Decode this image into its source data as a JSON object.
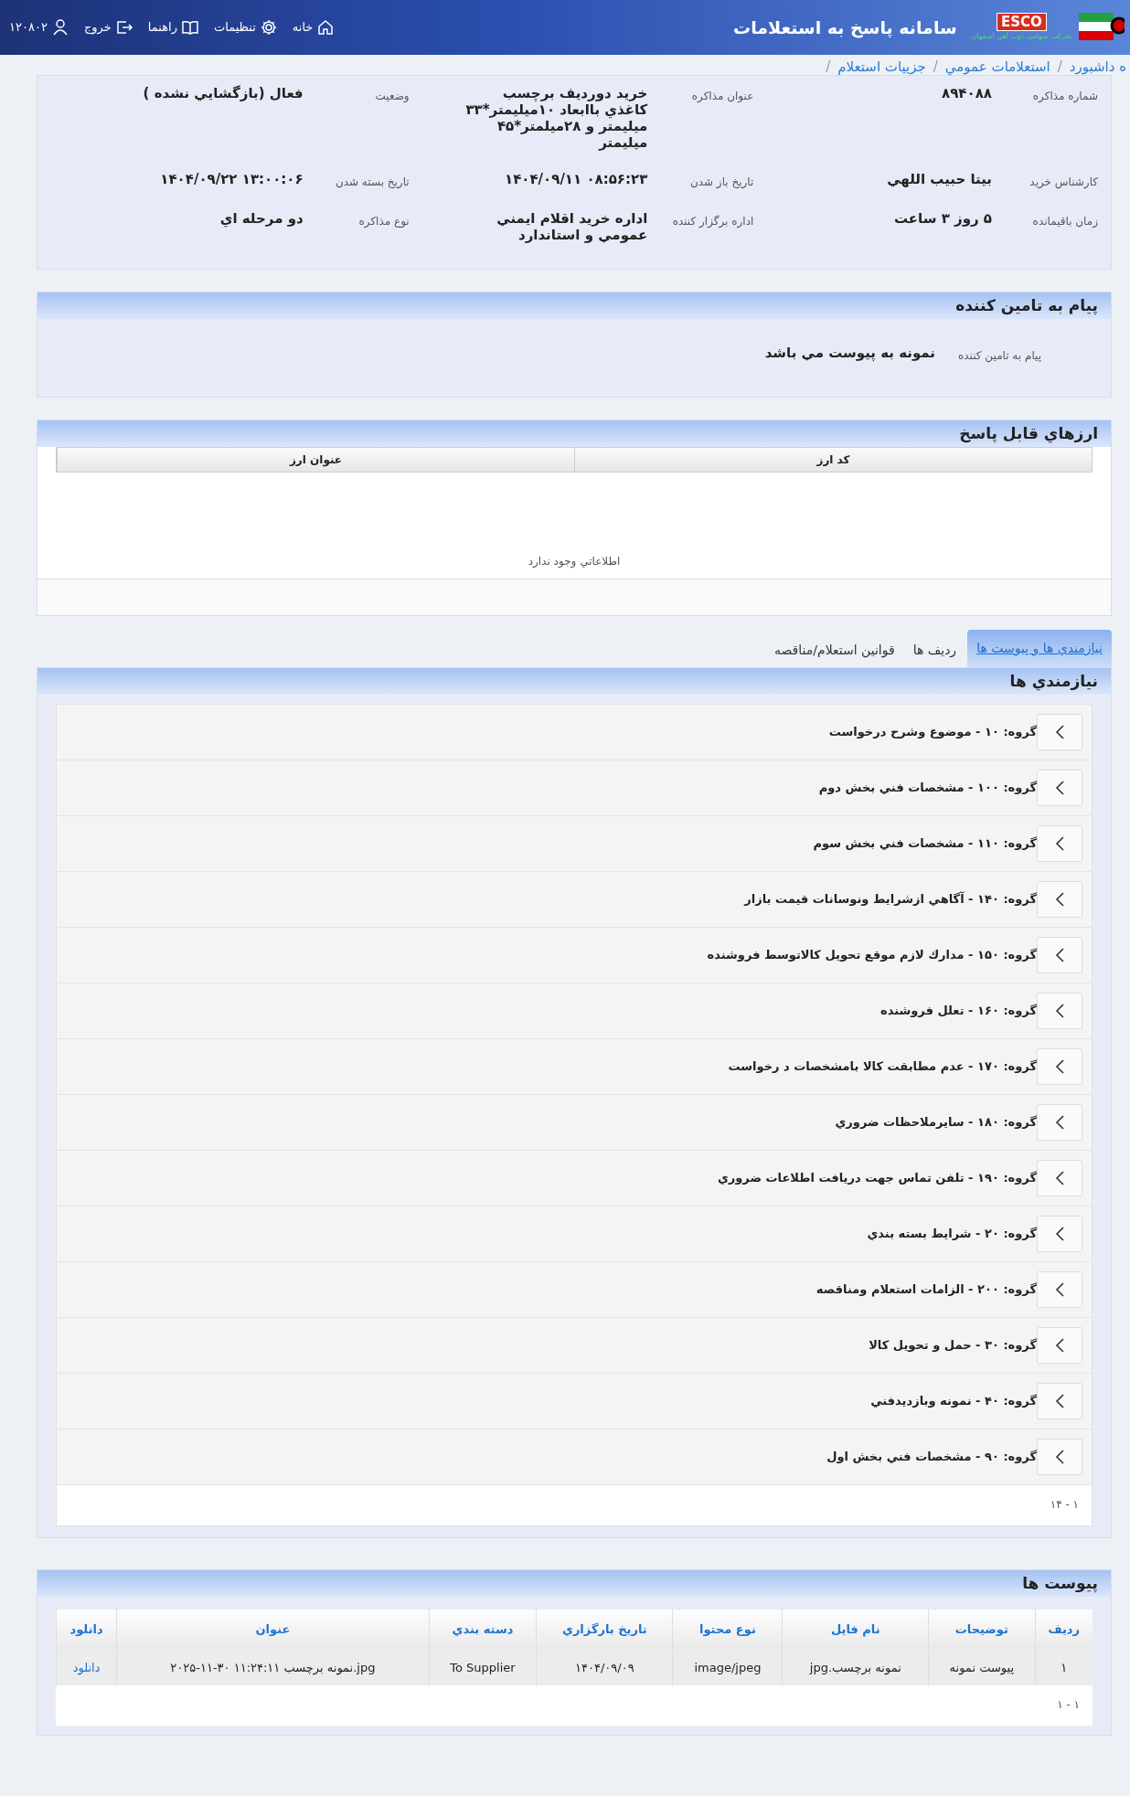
{
  "header": {
    "logo": {
      "brand": "ESCO",
      "company": "شرکت سهامی ذوب آهن اصفهان"
    },
    "title": "سامانه پاسخ به استعلامات",
    "nav": [
      {
        "kind": "home",
        "label": "خانه"
      },
      {
        "kind": "settings",
        "label": "تنظيمات"
      },
      {
        "kind": "help",
        "label": "راهنما"
      },
      {
        "kind": "logout",
        "label": "خروج"
      },
      {
        "kind": "user",
        "label": "۱۲۰۸۰۲"
      }
    ]
  },
  "breadcrumb": {
    "separator": "/",
    "items": [
      "ه داشبورد",
      "استعلامات عمومي",
      "جزييات استعلام"
    ]
  },
  "details": [
    {
      "label": "شماره مذاكره",
      "value": "۸۹۴۰۸۸"
    },
    {
      "label": "عنوان مذاكره",
      "value": "خريد دورديف برچسب كاغذي باابعاد ۱۰ميليمتر*۳۳ ميليمتر و ۲۸ميلمتر*۴۵ ميليمتر"
    },
    {
      "label": "وضعيت",
      "value": "فعال (بازگشايي نشده )"
    },
    {
      "label": "كارشناس خريد",
      "value": "بيتا حبيب اللهي"
    },
    {
      "label": "تاريخ باز شدن",
      "value": "۱۴۰۴/۰۹/۱۱ ۰۸:۵۶:۲۳",
      "kind": "datetime"
    },
    {
      "label": "تاريخ بسته شدن",
      "value": "۱۴۰۴/۰۹/۲۲ ۱۳:۰۰:۰۶",
      "kind": "datetime"
    },
    {
      "label": "زمان باقيمانده",
      "value": "۵ روز ۳ ساعت"
    },
    {
      "label": "اداره برگزار كننده",
      "value": "اداره خريد اقلام ايمني عمومي و استاندارد"
    },
    {
      "label": "نوع مذاكره",
      "value": "دو مرحله اي"
    }
  ],
  "supplier_message": {
    "title": "پيام به تامين كننده",
    "label": "پيام به تامين كننده",
    "value": "نمونه به پيوست مي باشد"
  },
  "currencies": {
    "title": "ارزهاي قابل پاسخ",
    "columns": [
      "كد ارز",
      "عنوان ارز"
    ],
    "empty_text": "اطلاعاتي وجود ندارد"
  },
  "tabs": [
    {
      "label": "نيازمندي ها و پيوست ها",
      "selected": true
    },
    {
      "label": "رديف ها",
      "selected": false
    },
    {
      "label": "قوانين استعلام/مناقصه",
      "selected": false
    }
  ],
  "requirements": {
    "title": "نيازمندي ها",
    "groups": [
      "گروه: ۱۰ - موضوع وشرح درخواست",
      "گروه: ۱۰۰ - مشخصات فني بخش دوم",
      "گروه: ۱۱۰ - مشخصات فني بخش سوم",
      "گروه: ۱۴۰ - آگاهي ازشرايط ونوسانات قيمت بازار",
      "گروه: ۱۵۰ - مدارك لازم موقع تحويل كالاتوسط فروشنده",
      "گروه: ۱۶۰ - تعلل فروشنده",
      "گروه: ۱۷۰ - عدم مطابقت كالا بامشخصات د رخواست",
      "گروه: ۱۸۰ - سايرملاحظات ضروري",
      "گروه: ۱۹۰ - تلفن تماس جهت دريافت اطلاعات ضروري",
      "گروه: ۲۰ - شرايط بسته بندي",
      "گروه: ۲۰۰ - الزامات استعلام ومناقصه",
      "گروه: ۳۰ - حمل و تحويل كالا",
      "گروه: ۴۰ - نمونه وبازديدفني",
      "گروه: ۹۰ - مشخصات فني بخش اول"
    ],
    "pagination": "۱ - ۱۴"
  },
  "attachments": {
    "title": "پيوست ها",
    "columns": [
      "رديف",
      "توضيحات",
      "نام فايل",
      "نوع محتوا",
      "تاريخ بارگزاري",
      "دسته بندي",
      "عنوان",
      "دانلود"
    ],
    "rows": [
      {
        "cells": [
          "۱",
          "پيوست نمونه",
          "نمونه برچسب.jpg",
          "image/jpeg",
          "۱۴۰۴/۰۹/۰۹",
          "To Supplier",
          "۲۰۲۵-۱۱-۳۰ ۱۱:۲۴:۱۱ نمونه برچسب.jpg"
        ],
        "download": "دانلود"
      }
    ],
    "pagination": "۱ - ۱"
  }
}
